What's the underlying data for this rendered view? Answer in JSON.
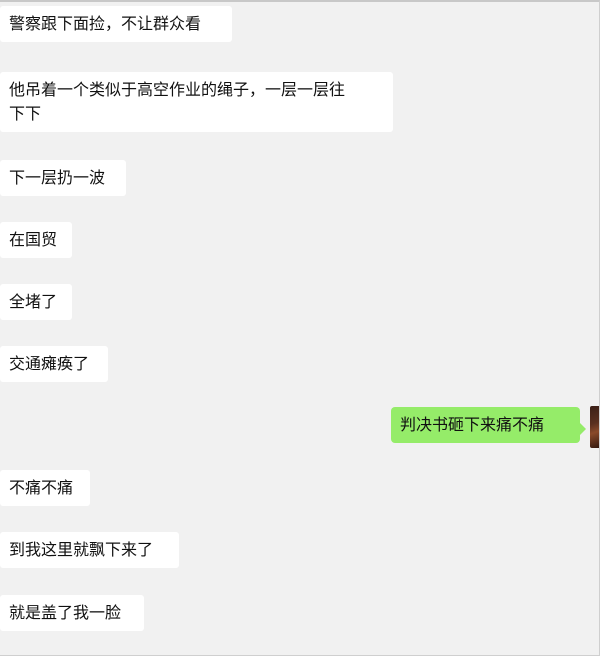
{
  "chat": {
    "messages": [
      {
        "side": "in",
        "text": "警察跟下面捡，不让群众看"
      },
      {
        "side": "in",
        "text": "他吊着一个类似于高空作业的绳子，一层一层往\n下下"
      },
      {
        "side": "in",
        "text": "下一层扔一波"
      },
      {
        "side": "in",
        "text": "在国贸"
      },
      {
        "side": "in",
        "text": "全堵了"
      },
      {
        "side": "in",
        "text": "交通瘫痪了"
      },
      {
        "side": "out",
        "text": "判决书砸下来痛不痛"
      },
      {
        "side": "in",
        "text": "不痛不痛"
      },
      {
        "side": "in",
        "text": "到我这里就飘下来了"
      },
      {
        "side": "in",
        "text": "就是盖了我一脸"
      }
    ]
  },
  "colors": {
    "incoming_bubble": "#ffffff",
    "outgoing_bubble": "#95ec69",
    "background": "#f1f1f1"
  }
}
